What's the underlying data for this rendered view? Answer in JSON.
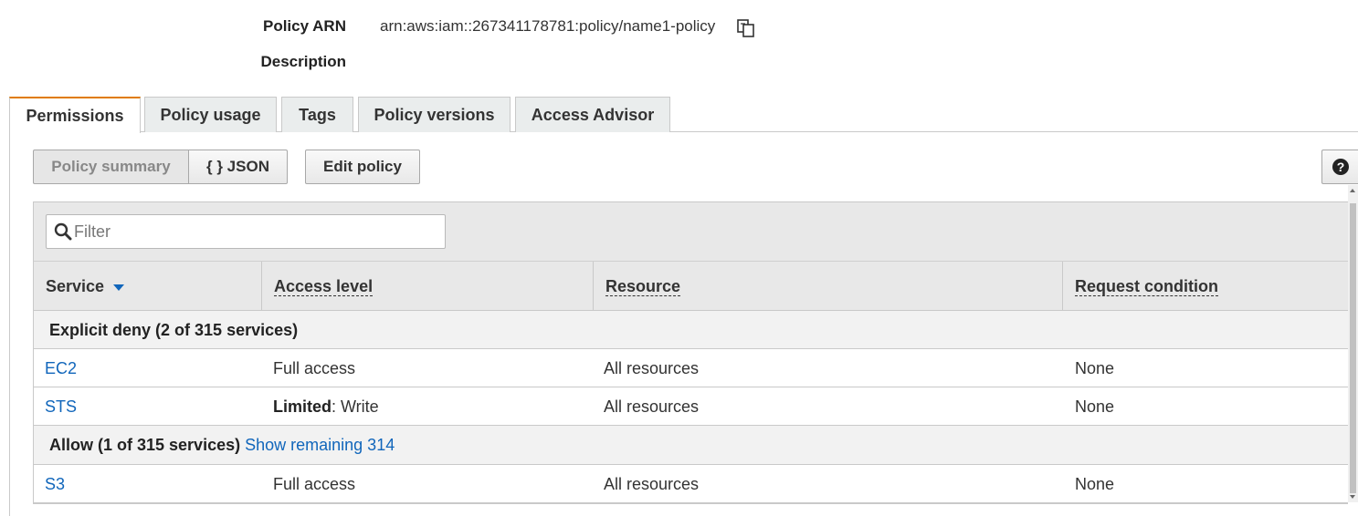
{
  "summary": {
    "policy_arn_label": "Policy ARN",
    "policy_arn_value": "arn:aws:iam::267341178781:policy/name1-policy",
    "description_label": "Description"
  },
  "tabs": [
    {
      "label": "Permissions",
      "active": true
    },
    {
      "label": "Policy usage",
      "active": false
    },
    {
      "label": "Tags",
      "active": false
    },
    {
      "label": "Policy versions",
      "active": false
    },
    {
      "label": "Access Advisor",
      "active": false
    }
  ],
  "toolbar": {
    "policy_summary_label": "Policy summary",
    "json_label": "{ } JSON",
    "edit_policy_label": "Edit policy",
    "help_icon": "question-circle-icon"
  },
  "filter": {
    "placeholder": "Filter",
    "icon": "search-icon"
  },
  "table": {
    "columns": [
      "Service",
      "Access level",
      "Resource",
      "Request condition"
    ],
    "sorted_column": "Service",
    "groups": [
      {
        "title": "Explicit deny (2 of 315 services)",
        "link": "",
        "rows": [
          {
            "service": "EC2",
            "access_bold": "",
            "access": "Full access",
            "resource": "All resources",
            "condition": "None"
          },
          {
            "service": "STS",
            "access_bold": "Limited",
            "access": ": Write",
            "resource": "All resources",
            "condition": "None"
          }
        ]
      },
      {
        "title": "Allow (1 of 315 services)",
        "link": "Show remaining 314",
        "rows": [
          {
            "service": "S3",
            "access_bold": "",
            "access": "Full access",
            "resource": "All resources",
            "condition": "None"
          }
        ]
      }
    ]
  },
  "colors": {
    "accent_tab": "#e07b00",
    "link": "#1166bb"
  }
}
